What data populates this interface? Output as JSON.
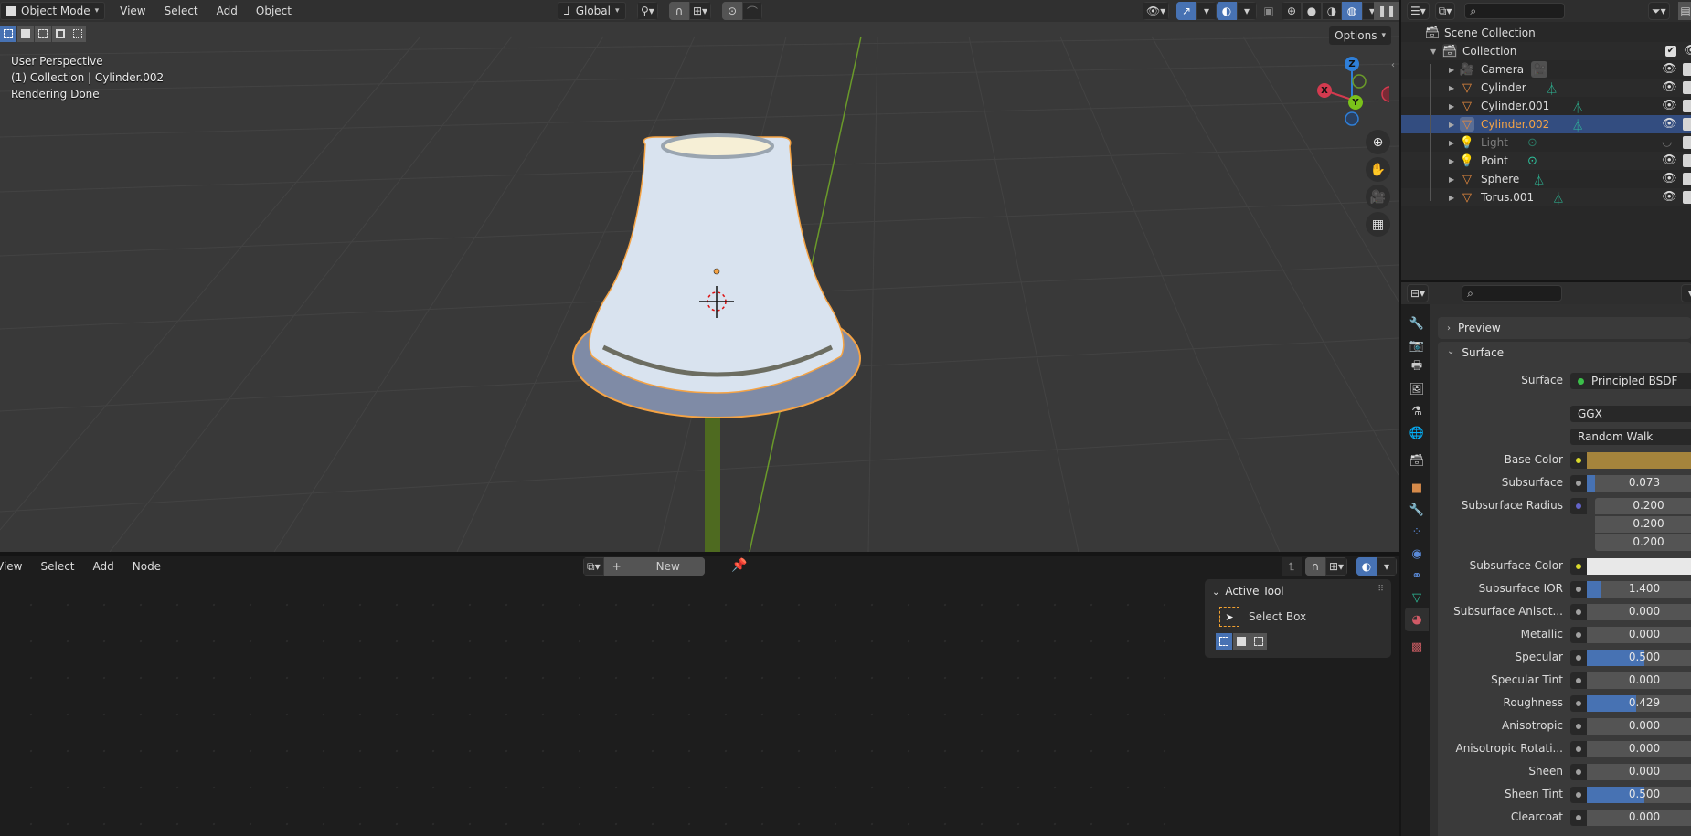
{
  "viewport": {
    "header": {
      "mode": "Object Mode",
      "menus": [
        "View",
        "Select",
        "Add",
        "Object"
      ],
      "transform_orientation": "Global",
      "shading_modes": [
        "wireframe",
        "solid",
        "material-preview",
        "rendered"
      ],
      "active_shading": "rendered"
    },
    "overlay_info": {
      "perspective": "User Perspective",
      "collection_object": "(1) Collection | Cylinder.002",
      "status": "Rendering Done"
    },
    "options_label": "Options",
    "gizmo": {
      "x": "X",
      "y": "Y",
      "z": "Z"
    },
    "nav_buttons": [
      "zoom-icon",
      "pan-hand-icon",
      "camera-view-icon",
      "perspective-grid-icon"
    ]
  },
  "node_editor": {
    "menus": [
      "View",
      "Select",
      "Add",
      "Node"
    ],
    "new_label": "New",
    "active_tool": {
      "title": "Active Tool",
      "tool_name": "Select Box"
    }
  },
  "outliner": {
    "root": "Scene Collection",
    "collection": "Collection",
    "items": [
      {
        "name": "Camera",
        "type": "camera",
        "selected": false,
        "dim": false
      },
      {
        "name": "Cylinder",
        "type": "mesh",
        "selected": false,
        "dim": false
      },
      {
        "name": "Cylinder.001",
        "type": "mesh",
        "selected": false,
        "dim": false
      },
      {
        "name": "Cylinder.002",
        "type": "mesh",
        "selected": true,
        "dim": false
      },
      {
        "name": "Light",
        "type": "light",
        "selected": false,
        "dim": true
      },
      {
        "name": "Point",
        "type": "light",
        "selected": false,
        "dim": false
      },
      {
        "name": "Sphere",
        "type": "mesh",
        "selected": false,
        "dim": false
      },
      {
        "name": "Torus.001",
        "type": "mesh",
        "selected": false,
        "dim": false
      }
    ]
  },
  "properties": {
    "panels": {
      "preview": "Preview",
      "surface": "Surface"
    },
    "surface_label": "Surface",
    "surface_shader": "Principled BSDF",
    "distribution": "GGX",
    "subsurface_method": "Random Walk",
    "fields": [
      {
        "label": "Base Color",
        "type": "color",
        "color": "#a5843c",
        "socket": "#d9d92c"
      },
      {
        "label": "Subsurface",
        "type": "slider",
        "value": "0.073",
        "fraction": 0.073,
        "socket": "#a1a1a1"
      },
      {
        "label": "Subsurface Radius",
        "type": "vector",
        "values": [
          "0.200",
          "0.200",
          "0.200"
        ],
        "socket": "#6363c7"
      },
      {
        "label": "Subsurface Color",
        "type": "color",
        "color": "#e8e8e8",
        "socket": "#d9d92c"
      },
      {
        "label": "Subsurface IOR",
        "type": "slider",
        "value": "1.400",
        "fraction": 0.12,
        "socket": "#a1a1a1"
      },
      {
        "label": "Subsurface Anisot...",
        "type": "slider",
        "value": "0.000",
        "fraction": 0,
        "socket": "#a1a1a1"
      },
      {
        "label": "Metallic",
        "type": "slider",
        "value": "0.000",
        "fraction": 0,
        "socket": "#a1a1a1"
      },
      {
        "label": "Specular",
        "type": "slider",
        "value": "0.500",
        "fraction": 0.5,
        "socket": "#a1a1a1"
      },
      {
        "label": "Specular Tint",
        "type": "slider",
        "value": "0.000",
        "fraction": 0,
        "socket": "#a1a1a1"
      },
      {
        "label": "Roughness",
        "type": "slider",
        "value": "0.429",
        "fraction": 0.429,
        "socket": "#a1a1a1"
      },
      {
        "label": "Anisotropic",
        "type": "slider",
        "value": "0.000",
        "fraction": 0,
        "socket": "#a1a1a1"
      },
      {
        "label": "Anisotropic Rotati...",
        "type": "slider",
        "value": "0.000",
        "fraction": 0,
        "socket": "#a1a1a1"
      },
      {
        "label": "Sheen",
        "type": "slider",
        "value": "0.000",
        "fraction": 0,
        "socket": "#a1a1a1"
      },
      {
        "label": "Sheen Tint",
        "type": "slider",
        "value": "0.500",
        "fraction": 0.5,
        "socket": "#a1a1a1"
      },
      {
        "label": "Clearcoat",
        "type": "slider",
        "value": "0.000",
        "fraction": 0,
        "socket": "#a1a1a1"
      }
    ],
    "tabs": [
      "tool",
      "render",
      "output",
      "view-layer",
      "scene",
      "world",
      "collection",
      "object",
      "modifiers",
      "particles",
      "physics",
      "constraints",
      "data",
      "material",
      "texture"
    ],
    "active_tab": "material"
  },
  "colors": {
    "accent_blue": "#4772b3",
    "selection_orange": "#f5a344",
    "outliner_selected": "#334d80",
    "mesh_data_green": "#2ebf9b",
    "object_orange": "#e68a3e"
  }
}
